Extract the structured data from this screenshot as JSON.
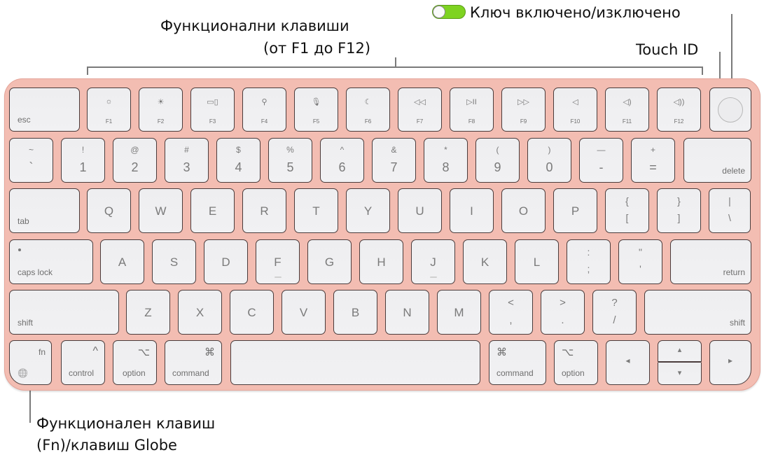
{
  "callouts": {
    "function_keys_line1": "Функционални клавиши",
    "function_keys_line2": "(от F1 до F12)",
    "power_switch": "Ключ включено/изключено",
    "touch_id": "Touch ID",
    "fn_globe_line1": "Функционален клавиш",
    "fn_globe_line2": "(Fn)/клавиш Globe"
  },
  "toggle": {
    "state": "on",
    "color": "#7ed321"
  },
  "keyboard": {
    "body_color": "#f3bdb2",
    "row_function": {
      "esc": "esc",
      "fkeys": [
        {
          "label": "F1",
          "icon": "brightness-down-icon",
          "glyph": "☼"
        },
        {
          "label": "F2",
          "icon": "brightness-up-icon",
          "glyph": "☀"
        },
        {
          "label": "F3",
          "icon": "mission-control-icon",
          "glyph": "▭▯"
        },
        {
          "label": "F4",
          "icon": "spotlight-search-icon",
          "glyph": "⚲"
        },
        {
          "label": "F5",
          "icon": "dictation-mic-icon",
          "glyph": "🎙"
        },
        {
          "label": "F6",
          "icon": "do-not-disturb-moon-icon",
          "glyph": "☾"
        },
        {
          "label": "F7",
          "icon": "rewind-icon",
          "glyph": "◁◁"
        },
        {
          "label": "F8",
          "icon": "play-pause-icon",
          "glyph": "▷II"
        },
        {
          "label": "F9",
          "icon": "fast-forward-icon",
          "glyph": "▷▷"
        },
        {
          "label": "F10",
          "icon": "mute-icon",
          "glyph": "◁"
        },
        {
          "label": "F11",
          "icon": "volume-down-icon",
          "glyph": "◁)"
        },
        {
          "label": "F12",
          "icon": "volume-up-icon",
          "glyph": "◁))"
        }
      ]
    },
    "row_number": {
      "keys": [
        {
          "top": "~",
          "main": "`"
        },
        {
          "top": "!",
          "main": "1"
        },
        {
          "top": "@",
          "main": "2"
        },
        {
          "top": "#",
          "main": "3"
        },
        {
          "top": "$",
          "main": "4"
        },
        {
          "top": "%",
          "main": "5"
        },
        {
          "top": "^",
          "main": "6"
        },
        {
          "top": "&",
          "main": "7"
        },
        {
          "top": "*",
          "main": "8"
        },
        {
          "top": "(",
          "main": "9"
        },
        {
          "top": ")",
          "main": "0"
        },
        {
          "top": "—",
          "main": "-"
        },
        {
          "top": "+",
          "main": "="
        }
      ],
      "delete": "delete"
    },
    "row_qwerty": {
      "tab": "tab",
      "letters": [
        "Q",
        "W",
        "E",
        "R",
        "T",
        "Y",
        "U",
        "I",
        "O",
        "P"
      ],
      "brackets": [
        {
          "top": "{",
          "main": "["
        },
        {
          "top": "}",
          "main": "]"
        },
        {
          "top": "|",
          "main": "\\"
        }
      ]
    },
    "row_home": {
      "caps": "caps lock",
      "letters": [
        "A",
        "S",
        "D",
        "F",
        "G",
        "H",
        "J",
        "K",
        "L"
      ],
      "punct": [
        {
          "top": ":",
          "main": ";"
        },
        {
          "top": "\"",
          "main": "'"
        }
      ],
      "return": "return"
    },
    "row_shift": {
      "shift_left": "shift",
      "letters": [
        "Z",
        "X",
        "C",
        "V",
        "B",
        "N",
        "M"
      ],
      "punct": [
        {
          "top": "<",
          "main": ","
        },
        {
          "top": ">",
          "main": "."
        },
        {
          "top": "?",
          "main": "/"
        }
      ],
      "shift_right": "shift"
    },
    "row_bottom": {
      "fn": "fn",
      "globe_glyph": "🌐",
      "control": "control",
      "control_glyph": "^",
      "option": "option",
      "option_glyph": "⌥",
      "command": "command",
      "command_glyph": "⌘",
      "arrow_left": "◂",
      "arrow_up": "▴",
      "arrow_down": "▾",
      "arrow_right": "▸"
    }
  }
}
